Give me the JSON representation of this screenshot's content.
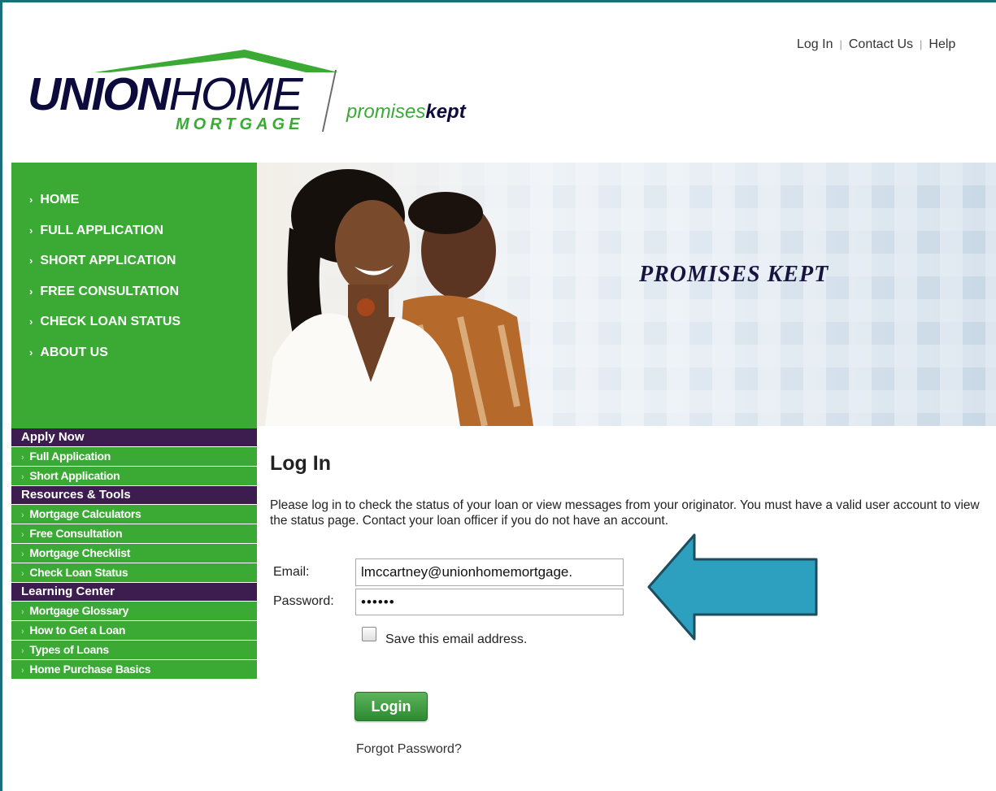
{
  "header": {
    "brand_part1": "UNION",
    "brand_part2": "HOME",
    "brand_sub": "MORTGAGE",
    "tagline_part1": "promises",
    "tagline_part2": "kept",
    "toplinks": [
      "Log In",
      "Contact Us",
      "Help"
    ]
  },
  "main_nav": {
    "items": [
      "HOME",
      "FULL APPLICATION",
      "SHORT APPLICATION",
      "FREE CONSULTATION",
      "CHECK LOAN STATUS",
      "ABOUT US"
    ]
  },
  "hero": {
    "title": "PROMISES KEPT"
  },
  "sidebar": {
    "apply_now": {
      "heading": "Apply Now",
      "items": [
        "Full Application",
        "Short Application"
      ]
    },
    "resources": {
      "heading": "Resources & Tools",
      "items": [
        "Mortgage Calculators",
        "Free Consultation",
        "Mortgage Checklist",
        "Check Loan Status"
      ]
    },
    "learning": {
      "heading": "Learning Center",
      "items": [
        "Mortgage Glossary",
        "How to Get a Loan",
        "Types of Loans",
        "Home Purchase Basics"
      ]
    }
  },
  "login": {
    "title": "Log In",
    "intro": "Please log in to check the status of your loan or view messages from your originator. You must have a valid user account to view the status page. Contact your loan officer if you do not have an account.",
    "email_label": "Email:",
    "email_value": "lmccartney@unionhomemortgage.",
    "password_label": "Password:",
    "password_value": "••••••",
    "save_label": "Save this email address.",
    "save_checked": false,
    "button_label": "Login",
    "forgot_label": "Forgot Password?"
  },
  "colors": {
    "green": "#3aaa35",
    "purple": "#3d1c4f",
    "navy": "#0d0a3c",
    "arrow": "#2ca0be"
  }
}
